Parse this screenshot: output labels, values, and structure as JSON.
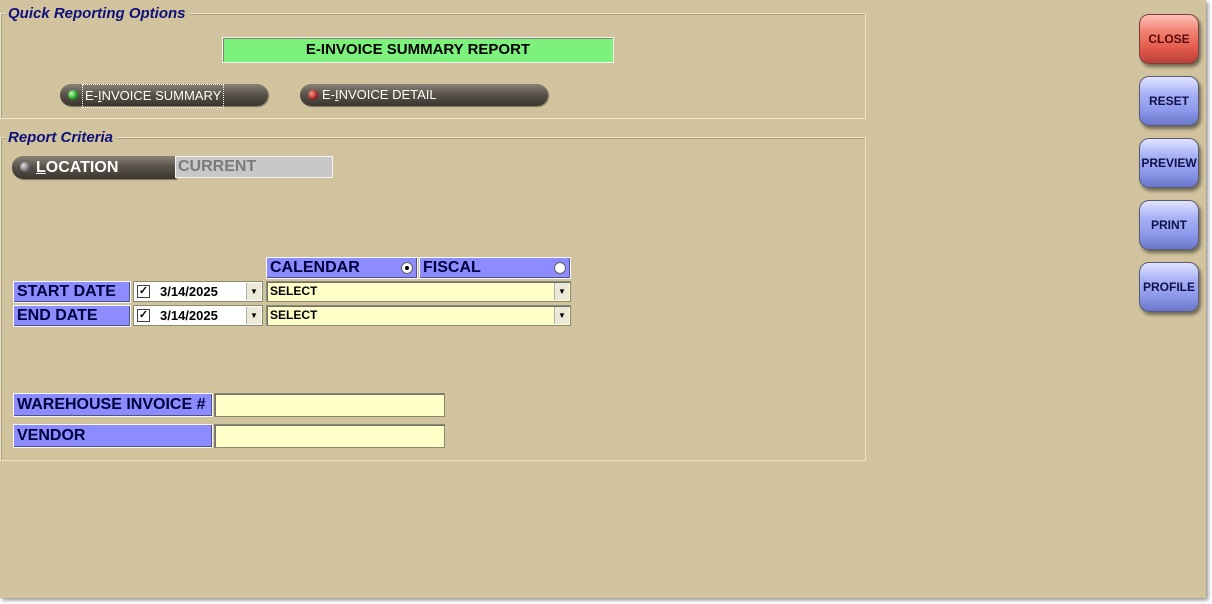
{
  "quick_reporting": {
    "group_title": "Quick Reporting Options",
    "report_title": "E-INVOICE SUMMARY REPORT",
    "options": [
      {
        "prefix": "E-",
        "accel": "I",
        "rest": "NVOICE SUMMARY",
        "led": "green",
        "selected": true
      },
      {
        "prefix": "E-",
        "accel": "I",
        "rest": "NVOICE DETAIL",
        "led": "red",
        "selected": false
      }
    ]
  },
  "criteria": {
    "group_title": "Report Criteria",
    "location": {
      "accel": "L",
      "rest": "OCATION",
      "value": "CURRENT"
    },
    "period": {
      "calendar_label": "CALENDAR",
      "fiscal_label": "FISCAL",
      "selected": "calendar"
    },
    "start_date": {
      "label": "START DATE",
      "checked": true,
      "date": "3/14/2025",
      "select": "SELECT"
    },
    "end_date": {
      "label": "END DATE",
      "checked": true,
      "date": "3/14/2025",
      "select": "SELECT"
    },
    "warehouse_invoice": {
      "label": "WAREHOUSE INVOICE #",
      "value": ""
    },
    "vendor": {
      "label": "VENDOR",
      "value": ""
    }
  },
  "side_buttons": {
    "close": "CLOSE",
    "reset": "RESET",
    "preview": "PREVIEW",
    "print": "PRINT",
    "profile": "PROFILE"
  },
  "colors": {
    "background": "#d0c39d",
    "title_green": "#7cf27c",
    "label_blue": "#8c8cff",
    "field_yellow": "#ffffc8",
    "close_red": "#e25a4c",
    "button_blue": "#8c98ea"
  }
}
